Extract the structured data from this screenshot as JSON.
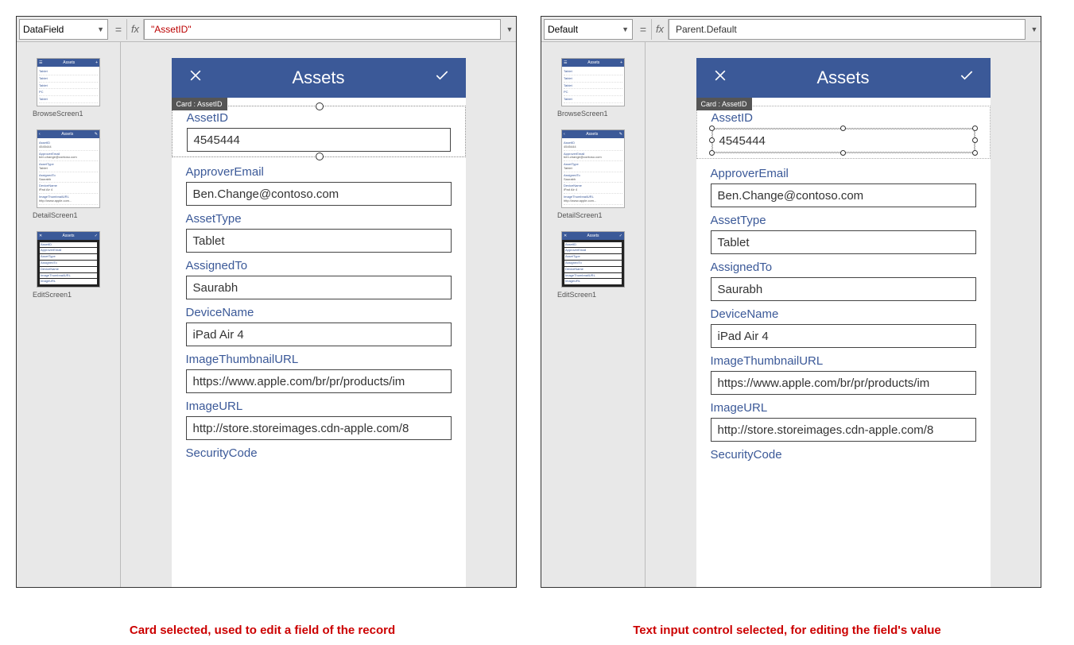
{
  "pane1": {
    "property": "DataField",
    "formula": "\"AssetID\"",
    "card_tag": "Card : AssetID"
  },
  "pane2": {
    "property": "Default",
    "formula": "Parent.Default",
    "card_tag": "Card : AssetID"
  },
  "common": {
    "fx": "fx",
    "eq": "=",
    "app_title": "Assets",
    "thumbs": {
      "browse_label": "BrowseScreen1",
      "detail_label": "DetailScreen1",
      "edit_label": "EditScreen1"
    },
    "fields": [
      {
        "label": "AssetID",
        "value": "4545444"
      },
      {
        "label": "ApproverEmail",
        "value": "Ben.Change@contoso.com"
      },
      {
        "label": "AssetType",
        "value": "Tablet"
      },
      {
        "label": "AssignedTo",
        "value": "Saurabh"
      },
      {
        "label": "DeviceName",
        "value": "iPad Air 4"
      },
      {
        "label": "ImageThumbnailURL",
        "value": "https://www.apple.com/br/pr/products/im"
      },
      {
        "label": "ImageURL",
        "value": "http://store.storeimages.cdn-apple.com/8"
      },
      {
        "label": "SecurityCode",
        "value": ""
      }
    ]
  },
  "captions": {
    "left": "Card selected, used to edit a field of the record",
    "right": "Text input control selected, for editing the field's value"
  }
}
